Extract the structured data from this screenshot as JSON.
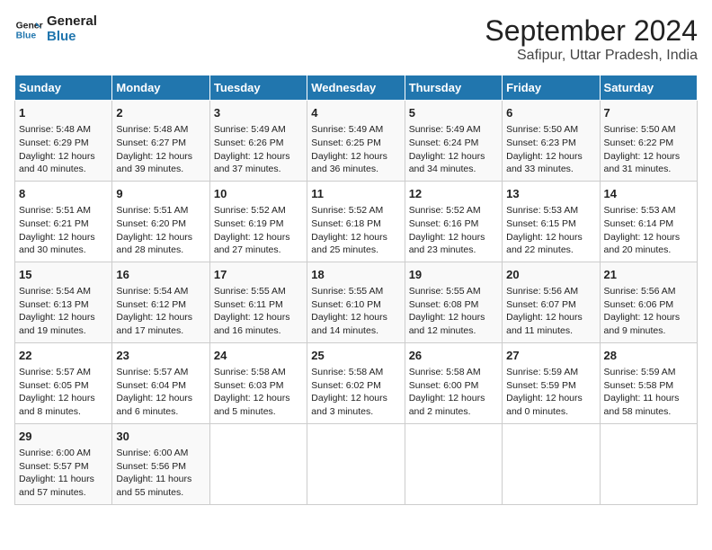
{
  "header": {
    "logo_line1": "General",
    "logo_line2": "Blue",
    "month_title": "September 2024",
    "subtitle": "Safipur, Uttar Pradesh, India"
  },
  "days_of_week": [
    "Sunday",
    "Monday",
    "Tuesday",
    "Wednesday",
    "Thursday",
    "Friday",
    "Saturday"
  ],
  "weeks": [
    [
      {
        "day": "1",
        "info": "Sunrise: 5:48 AM\nSunset: 6:29 PM\nDaylight: 12 hours\nand 40 minutes."
      },
      {
        "day": "2",
        "info": "Sunrise: 5:48 AM\nSunset: 6:27 PM\nDaylight: 12 hours\nand 39 minutes."
      },
      {
        "day": "3",
        "info": "Sunrise: 5:49 AM\nSunset: 6:26 PM\nDaylight: 12 hours\nand 37 minutes."
      },
      {
        "day": "4",
        "info": "Sunrise: 5:49 AM\nSunset: 6:25 PM\nDaylight: 12 hours\nand 36 minutes."
      },
      {
        "day": "5",
        "info": "Sunrise: 5:49 AM\nSunset: 6:24 PM\nDaylight: 12 hours\nand 34 minutes."
      },
      {
        "day": "6",
        "info": "Sunrise: 5:50 AM\nSunset: 6:23 PM\nDaylight: 12 hours\nand 33 minutes."
      },
      {
        "day": "7",
        "info": "Sunrise: 5:50 AM\nSunset: 6:22 PM\nDaylight: 12 hours\nand 31 minutes."
      }
    ],
    [
      {
        "day": "8",
        "info": "Sunrise: 5:51 AM\nSunset: 6:21 PM\nDaylight: 12 hours\nand 30 minutes."
      },
      {
        "day": "9",
        "info": "Sunrise: 5:51 AM\nSunset: 6:20 PM\nDaylight: 12 hours\nand 28 minutes."
      },
      {
        "day": "10",
        "info": "Sunrise: 5:52 AM\nSunset: 6:19 PM\nDaylight: 12 hours\nand 27 minutes."
      },
      {
        "day": "11",
        "info": "Sunrise: 5:52 AM\nSunset: 6:18 PM\nDaylight: 12 hours\nand 25 minutes."
      },
      {
        "day": "12",
        "info": "Sunrise: 5:52 AM\nSunset: 6:16 PM\nDaylight: 12 hours\nand 23 minutes."
      },
      {
        "day": "13",
        "info": "Sunrise: 5:53 AM\nSunset: 6:15 PM\nDaylight: 12 hours\nand 22 minutes."
      },
      {
        "day": "14",
        "info": "Sunrise: 5:53 AM\nSunset: 6:14 PM\nDaylight: 12 hours\nand 20 minutes."
      }
    ],
    [
      {
        "day": "15",
        "info": "Sunrise: 5:54 AM\nSunset: 6:13 PM\nDaylight: 12 hours\nand 19 minutes."
      },
      {
        "day": "16",
        "info": "Sunrise: 5:54 AM\nSunset: 6:12 PM\nDaylight: 12 hours\nand 17 minutes."
      },
      {
        "day": "17",
        "info": "Sunrise: 5:55 AM\nSunset: 6:11 PM\nDaylight: 12 hours\nand 16 minutes."
      },
      {
        "day": "18",
        "info": "Sunrise: 5:55 AM\nSunset: 6:10 PM\nDaylight: 12 hours\nand 14 minutes."
      },
      {
        "day": "19",
        "info": "Sunrise: 5:55 AM\nSunset: 6:08 PM\nDaylight: 12 hours\nand 12 minutes."
      },
      {
        "day": "20",
        "info": "Sunrise: 5:56 AM\nSunset: 6:07 PM\nDaylight: 12 hours\nand 11 minutes."
      },
      {
        "day": "21",
        "info": "Sunrise: 5:56 AM\nSunset: 6:06 PM\nDaylight: 12 hours\nand 9 minutes."
      }
    ],
    [
      {
        "day": "22",
        "info": "Sunrise: 5:57 AM\nSunset: 6:05 PM\nDaylight: 12 hours\nand 8 minutes."
      },
      {
        "day": "23",
        "info": "Sunrise: 5:57 AM\nSunset: 6:04 PM\nDaylight: 12 hours\nand 6 minutes."
      },
      {
        "day": "24",
        "info": "Sunrise: 5:58 AM\nSunset: 6:03 PM\nDaylight: 12 hours\nand 5 minutes."
      },
      {
        "day": "25",
        "info": "Sunrise: 5:58 AM\nSunset: 6:02 PM\nDaylight: 12 hours\nand 3 minutes."
      },
      {
        "day": "26",
        "info": "Sunrise: 5:58 AM\nSunset: 6:00 PM\nDaylight: 12 hours\nand 2 minutes."
      },
      {
        "day": "27",
        "info": "Sunrise: 5:59 AM\nSunset: 5:59 PM\nDaylight: 12 hours\nand 0 minutes."
      },
      {
        "day": "28",
        "info": "Sunrise: 5:59 AM\nSunset: 5:58 PM\nDaylight: 11 hours\nand 58 minutes."
      }
    ],
    [
      {
        "day": "29",
        "info": "Sunrise: 6:00 AM\nSunset: 5:57 PM\nDaylight: 11 hours\nand 57 minutes."
      },
      {
        "day": "30",
        "info": "Sunrise: 6:00 AM\nSunset: 5:56 PM\nDaylight: 11 hours\nand 55 minutes."
      },
      null,
      null,
      null,
      null,
      null
    ]
  ]
}
